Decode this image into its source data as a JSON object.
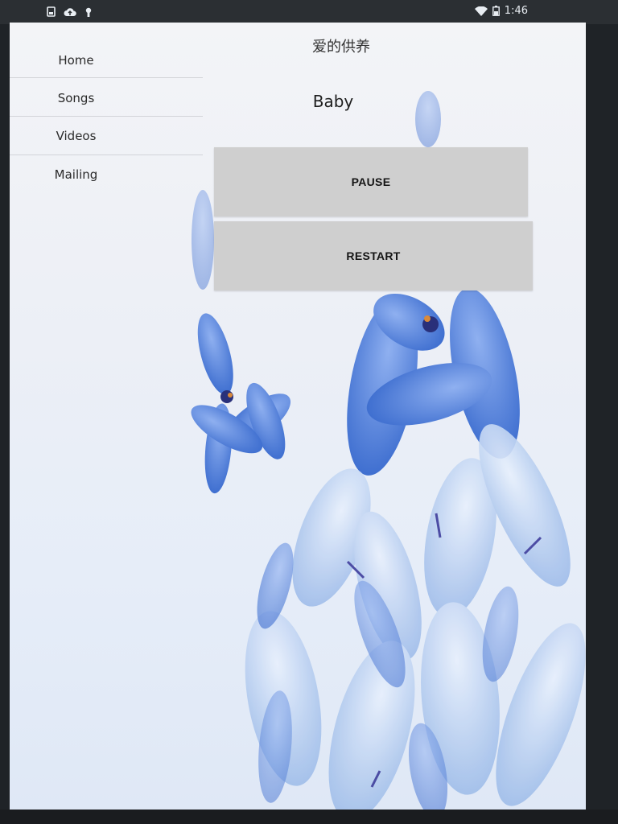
{
  "status_bar": {
    "time": "1:46",
    "icons_left": [
      "sim-card-icon",
      "cloud-upload-icon",
      "android-debug-icon"
    ],
    "icons_right": [
      "wifi-icon",
      "battery-icon"
    ]
  },
  "drawer": {
    "items": [
      {
        "label": "Home"
      },
      {
        "label": "Songs"
      },
      {
        "label": "Videos"
      },
      {
        "label": "Mailing"
      }
    ]
  },
  "header": {
    "title": "爱的供养"
  },
  "player": {
    "song_title": "Baby",
    "pause_label": "PAUSE",
    "restart_label": "RESTART"
  },
  "background": {
    "motif": "blue flowers",
    "accent_color": "#4f7fd8"
  }
}
